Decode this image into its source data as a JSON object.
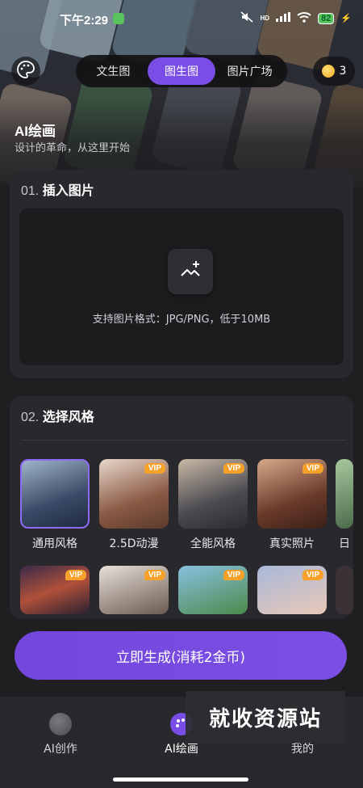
{
  "status_bar": {
    "time": "下午2:29",
    "battery": "82",
    "network": "HD"
  },
  "tabs": [
    {
      "label": "文生图",
      "active": false
    },
    {
      "label": "图生图",
      "active": true
    },
    {
      "label": "图片广场",
      "active": false
    }
  ],
  "coins": "3",
  "header": {
    "title": "AI绘画",
    "subtitle": "设计的革命，从这里开始"
  },
  "section1": {
    "num": "01.",
    "title": "插入图片",
    "hint": "支持图片格式：JPG/PNG，低于10MB"
  },
  "section2": {
    "num": "02.",
    "title": "选择风格",
    "vip_label": "VIP",
    "styles_row1": [
      {
        "label": "通用风格",
        "vip": false,
        "selected": true
      },
      {
        "label": "2.5D动漫",
        "vip": true,
        "selected": false
      },
      {
        "label": "全能风格",
        "vip": true,
        "selected": false
      },
      {
        "label": "真实照片",
        "vip": true,
        "selected": false
      },
      {
        "label": "日",
        "vip": false,
        "selected": false
      }
    ],
    "styles_row2_vip": [
      true,
      true,
      true,
      true
    ]
  },
  "generate_label": "立即生成(消耗2金币)",
  "bottom_nav": [
    {
      "label": "AI创作",
      "active": false
    },
    {
      "label": "AI绘画",
      "active": true
    },
    {
      "label": "我的",
      "active": false
    }
  ],
  "watermark": "就收资源站",
  "colors": {
    "accent": "#7a4ee6",
    "vip": "#f5a12a",
    "card": "#29292d",
    "background": "#1f1f22"
  }
}
